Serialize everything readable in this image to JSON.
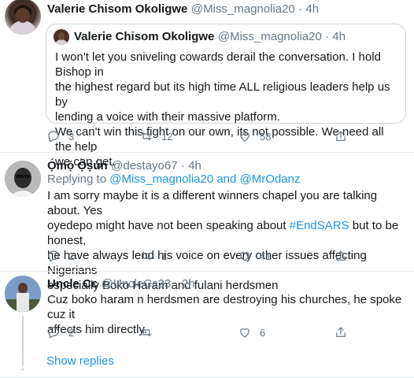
{
  "tweet1": {
    "name": "Valerie Chisom Okoligwe",
    "handle": "@Miss_magnolia20",
    "time": "· 4h",
    "quote": {
      "name": "Valerie Chisom Okoligwe",
      "handle": "@Miss_magnolia20",
      "time": "· 4h",
      "line1": "I won't let you sniveling cowards derail the conversation. I hold Bishop in",
      "line2": "the highest regard but its high time ALL religious leaders help us by",
      "line3": "lending a voice with their massive platform.",
      "line4": "We can't win this fight on our own, its not possible. We need all the help",
      "line5": "we can get."
    },
    "replies": "3",
    "retweets": "12",
    "likes": "58"
  },
  "tweet2": {
    "name": "Ọ́mọ́ Ọ̀ṣún",
    "handle": "@destayo67",
    "time": "· 4h",
    "replying_prefix": "Replying to ",
    "replying_to": "@Miss_magnolia20 and @MrOdanz",
    "line1": "I am sorry maybe it is a different winners chapel you are talking about. Yes",
    "line2a": "oyedepo might have not been speaking about ",
    "hashtag": "#EndSARS",
    "line2b": " but to be honest,",
    "line3": "he have always lend his voice on every other issues affecting Nigerians",
    "line4": "especially Boko Haram and fulani herdsmen",
    "replies": "2",
    "retweets": "1",
    "likes": "41"
  },
  "tweet3": {
    "name": "Uncle Cc",
    "handle": "@UncleCc23",
    "time": "· 2h",
    "line1": "Cuz boko haram n herdsmen are destroying his churches, he spoke cuz it",
    "line2": "affects him directly.",
    "replies": "2",
    "likes": "6"
  },
  "show_replies": "Show replies"
}
